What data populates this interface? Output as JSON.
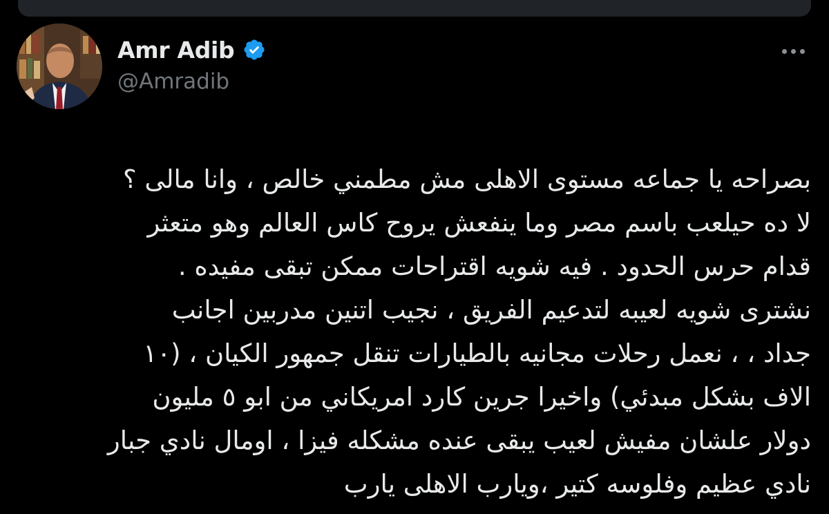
{
  "tweet": {
    "author": {
      "display_name": "Amr Adib",
      "handle": "@Amradib",
      "verified": true,
      "verified_icon": "verified-badge-icon",
      "avatar_icon": "profile-avatar"
    },
    "more_icon": "more-options-icon",
    "lines": [
      "بصراحه يا جماعه مستوى الاهلى مش مطمني خالص ، وانا مالى ؟",
      "لا ده حيلعب باسم مصر وما ينفعش يروح كاس العالم وهو متعثر",
      "قدام حرس الحدود . فيه شويه اقتراحات ممكن تبقى مفيده .",
      "نشترى شويه لعيبه لتدعيم الفريق ، نجيب اتنين مدربين اجانب",
      "جداد ، ، نعمل رحلات مجانيه بالطيارات تنقل جمهور الكيان ، (١٠",
      "الاف بشكل مبدئي) واخيرا جرين كارد امريكاني من ابو ٥ مليون",
      "دولار علشان مفيش لعيب يبقى عنده مشكله فيزا ، اومال نادي جبار",
      "نادي عظيم وفلوسه كتير ،ويارب الاهلى يارب"
    ]
  },
  "colors": {
    "background": "#000000",
    "text_primary": "#e7e9ea",
    "text_secondary": "#71767b",
    "verified_blue": "#1d9bf0",
    "card_surface": "#202327"
  }
}
